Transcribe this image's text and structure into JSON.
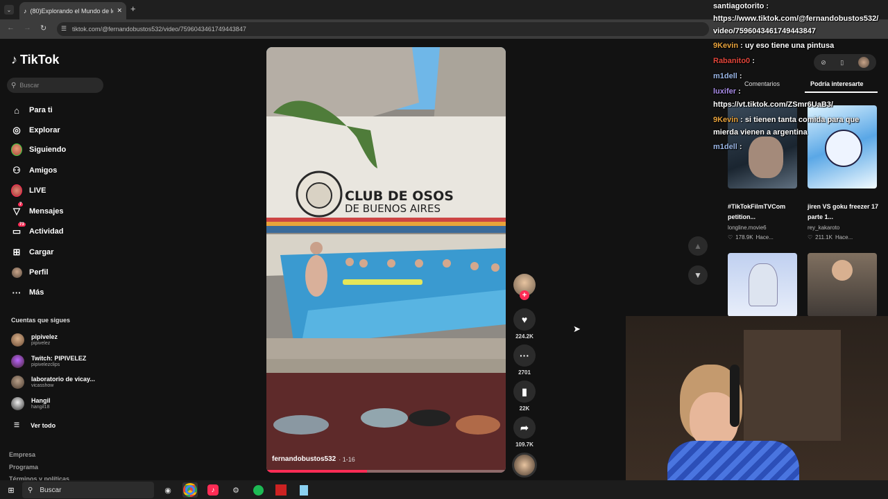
{
  "browser": {
    "tab_title": "(80)Explorando el Mundo de lo",
    "url": "tiktok.com/@fernandobustos532/video/7596043461749443847",
    "close_glyph": "✕",
    "new_tab_glyph": "+"
  },
  "sidebar": {
    "logo": "TikTok",
    "search_placeholder": "Buscar",
    "nav": [
      {
        "label": "Para ti",
        "icon": "home-icon"
      },
      {
        "label": "Explorar",
        "icon": "compass-icon"
      },
      {
        "label": "Siguiendo",
        "icon": "avatar-icon"
      },
      {
        "label": "Amigos",
        "icon": "friends-icon"
      },
      {
        "label": "LIVE",
        "icon": "live-icon"
      },
      {
        "label": "Mensajes",
        "icon": "message-icon",
        "badge": "7"
      },
      {
        "label": "Actividad",
        "icon": "activity-icon",
        "badge": "73"
      },
      {
        "label": "Cargar",
        "icon": "upload-icon"
      },
      {
        "label": "Perfil",
        "icon": "profile-icon"
      },
      {
        "label": "Más",
        "icon": "more-icon"
      }
    ],
    "following_header": "Cuentas que sigues",
    "following": [
      {
        "name": "pipivelez",
        "handle": "pipivelez"
      },
      {
        "name": "Twitch: PIPIVELEZ",
        "handle": "pipivelezclips"
      },
      {
        "name": "laboratorio de vicay...",
        "handle": "vicasshow"
      },
      {
        "name": "Hangil",
        "handle": "hangil18"
      }
    ],
    "see_all": "Ver todo",
    "footer": [
      "Empresa",
      "Programa",
      "Términos y políticas"
    ]
  },
  "video": {
    "sign_line1": "CLUB DE OSOS",
    "sign_line2": "DE BUENOS AIRES",
    "author": "fernandobustos532",
    "date": "· 1-16",
    "progress_fraction": 0.42
  },
  "actions": {
    "likes": "224.2K",
    "comments": "2701",
    "saves": "22K",
    "shares": "109.7K"
  },
  "right_panel": {
    "tabs": [
      "Comentarios",
      "Podría interesarte"
    ],
    "cards": [
      {
        "title": "#TikTokFilmTVCom petition...",
        "author": "longline.movie6",
        "likes": "178.9K",
        "time": "Hace..."
      },
      {
        "title": "jiren VS goku freezer 17 parte 1...",
        "author": "rey_kakaroto",
        "likes": "211.1K",
        "time": "Hace..."
      }
    ]
  },
  "chat": [
    {
      "user": "santiagotorito",
      "text": "",
      "color": "#ffffff"
    },
    {
      "user": "",
      "text": "https://www.tiktok.com/@fernandobustos532/",
      "color": "#ffffff"
    },
    {
      "user": "",
      "text": "video/7596043461749443847",
      "color": "#ffffff"
    },
    {
      "user": "9Kevin",
      "text": "uy eso tiene una pintusa",
      "color": "#e8a33d"
    },
    {
      "user": "Rabanito0",
      "text": "",
      "color": "#e0463b"
    },
    {
      "user": "m1dell",
      "text": "",
      "color": "#9ab6e6"
    },
    {
      "user": "luxifer",
      "text": "",
      "color": "#a98ce8"
    },
    {
      "user": "",
      "text": "https://vt.tiktok.com/ZSmr6UaB3/",
      "color": "#ffffff"
    },
    {
      "user": "9Kevin",
      "text": "si tienen tanta comida para que",
      "color": "#e8a33d"
    },
    {
      "user": "",
      "text": "mierda vienen a argentina",
      "color": "#ffffff"
    },
    {
      "user": "m1dell",
      "text": "",
      "color": "#9ab6e6"
    }
  ],
  "taskbar": {
    "search_placeholder": "Buscar"
  },
  "colors": {
    "brand": "#fe2c55",
    "pool": "#3a9ad0",
    "sky": "#6fb7e8"
  }
}
